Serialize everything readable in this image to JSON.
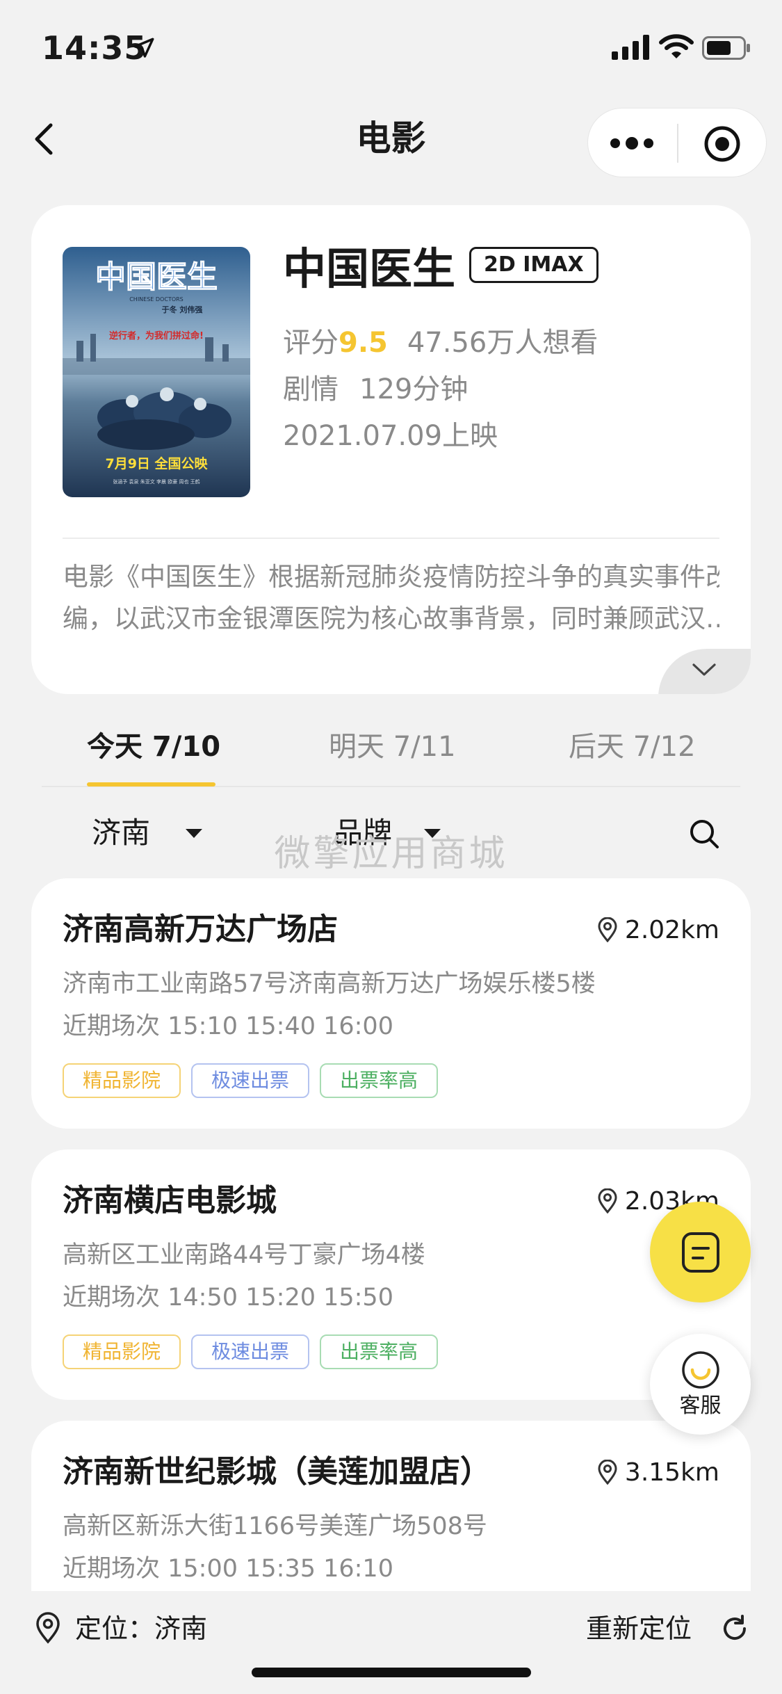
{
  "status_bar": {
    "time": "14:35"
  },
  "nav": {
    "title": "电影"
  },
  "movie": {
    "name": "中国医生",
    "format": "2D IMAX",
    "score_label": "评分",
    "score": "9.5",
    "want_count": "47.56万人想看",
    "genre": "剧情",
    "duration": "129分钟",
    "release": "2021.07.09上映",
    "synopsis_line1": "电影《中国医生》根据新冠肺炎疫情防控斗争的真实事件改",
    "synopsis_line2": "编，以武汉市金银潭医院为核心故事背景，同时兼顾武汉…",
    "poster": {
      "title": "中国医生",
      "subtitle": "CHINESE DOCTORS",
      "director": "于冬 刘伟强",
      "slogan": "逆行者，为我们拼过命!",
      "release_text": "7月9日 全国公映",
      "cast": "张涵予 袁泉 朱亚文 李晨 欧豪 周也 王鹤"
    }
  },
  "date_tabs": [
    {
      "label": "今天",
      "date": "7/10"
    },
    {
      "label": "明天",
      "date": "7/11"
    },
    {
      "label": "后天",
      "date": "7/12"
    }
  ],
  "filters": {
    "city": "济南",
    "brand": "品牌"
  },
  "watermark": "微擎应用商城",
  "cinemas": [
    {
      "name": "济南高新万达广场店",
      "distance": "2.02km",
      "address": "济南市工业南路57号济南高新万达广场娱乐楼5楼",
      "showtimes": "近期场次 15:10 15:40 16:00",
      "tags": [
        "精品影院",
        "极速出票",
        "出票率高"
      ]
    },
    {
      "name": "济南横店电影城",
      "distance": "2.03km",
      "address": "高新区工业南路44号丁豪广场4楼",
      "showtimes": "近期场次 14:50 15:20 15:50",
      "tags": [
        "精品影院",
        "极速出票",
        "出票率高"
      ]
    },
    {
      "name": "济南新世纪影城（美莲加盟店）",
      "distance": "3.15km",
      "address": "高新区新泺大街1166号美莲广场508号",
      "showtimes": "近期场次 15:00 15:35 16:10",
      "tags": []
    }
  ],
  "service": {
    "label": "客服"
  },
  "location": {
    "text": "定位：济南",
    "relocate": "重新定位"
  },
  "colors": {
    "accent": "#f5c531",
    "fab": "#f7e046",
    "background": "#f2f2f2",
    "tag_gold": "#f0b432",
    "tag_blue": "#6e8ce0",
    "tag_green": "#4caf61"
  },
  "icons": [
    "location-arrow-icon",
    "signal-icon",
    "wifi-icon",
    "battery-icon",
    "back-icon",
    "more-icon",
    "target-icon",
    "chevron-down-icon",
    "caret-down-icon",
    "search-icon",
    "pin-icon",
    "chat-icon",
    "customer-service-icon",
    "refresh-icon"
  ]
}
